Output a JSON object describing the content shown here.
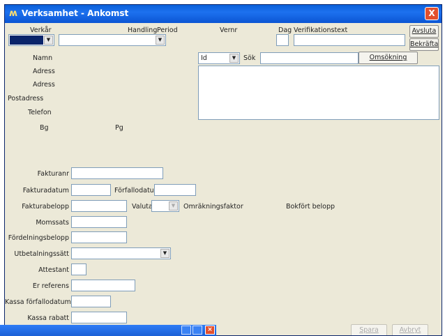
{
  "window": {
    "title": "Verksamhet - Ankomst",
    "close": "X"
  },
  "header": {
    "verkar": "Verkår",
    "handling": "Handling",
    "period": "Period",
    "vernr": "Vernr",
    "dag": "Dag",
    "verifikationstext": "Verifikationstext"
  },
  "buttons": {
    "avsluta": "Avsluta",
    "bekrafta": "Bekräfta",
    "omsokning": "Omsökning",
    "spara": "Spara",
    "avbryt": "Avbryt"
  },
  "search": {
    "field_option": "Id",
    "sok_label": "Sök"
  },
  "party": {
    "namn": "Namn",
    "adress1": "Adress",
    "adress2": "Adress",
    "postadress": "Postadress",
    "telefon": "Telefon",
    "bg": "Bg",
    "pg": "Pg"
  },
  "form": {
    "fakturanr": "Fakturanr",
    "fakturadatum": "Fakturadatum",
    "forfallodatum": "Förfallodatum",
    "fakturabelopp": "Fakturabelopp",
    "valuta": "Valuta",
    "omrakningsfaktor": "Omräkningsfaktor",
    "bokfort_belopp": "Bokfört belopp",
    "momssats": "Momssats",
    "fordelningsbelopp": "Fördelningsbelopp",
    "utbetalningssatt": "Utbetalningssätt",
    "attestant": "Attestant",
    "er_referens": "Er referens",
    "kassa_forfallodatum": "Kassa förfallodatum",
    "kassa_rabatt": "Kassa rabatt"
  }
}
